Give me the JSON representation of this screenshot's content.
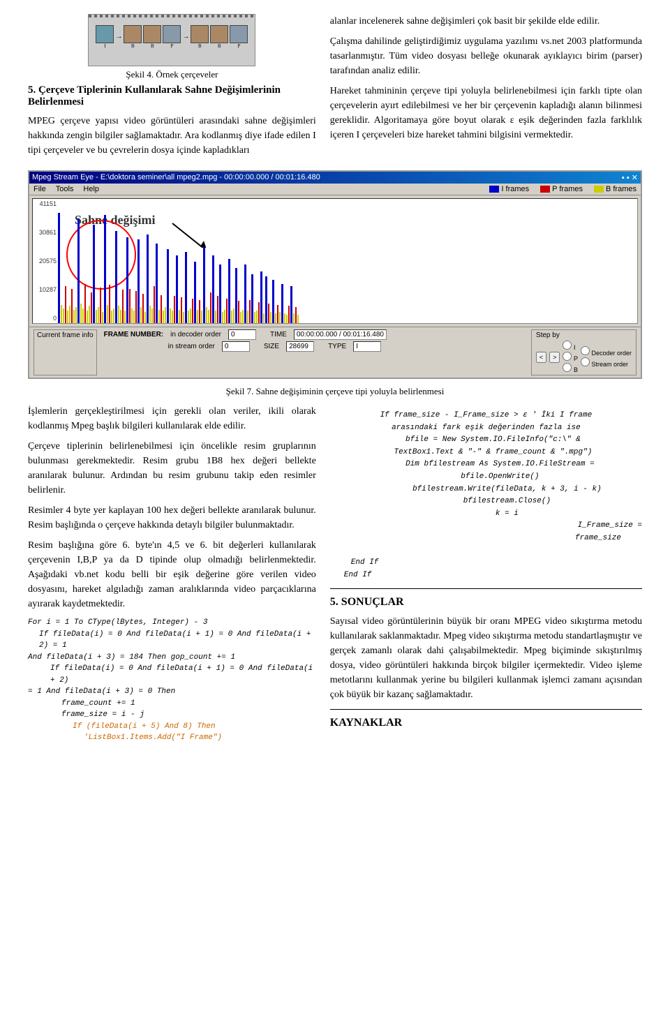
{
  "top": {
    "figure4_caption": "Şekil 4. Örnek çerçeveler",
    "right_para1": "alanlar incelenerek sahne değişimleri çok basit bir şekilde elde edilir.",
    "right_para2": "Çalışma dahilinde geliştirdiğimiz uygulama yazılımı vs.net 2003 platformunda tasarlanmıştır. Tüm video dosyası belleğe okunarak ayıklayıcı birim (parser) tarafından analiz edilir."
  },
  "section5": {
    "title": "5. Çerçeve Tiplerinin Kullanılarak Sahne Değişimlerinin Belirlenmesi",
    "para1": "MPEG çerçeve yapısı video görüntüleri arasındaki sahne değişimleri hakkında zengin bilgiler sağlamaktadır. Ara kodlanmış diye ifade edilen I tipi çerçeveler ve bu çevrelerin dosya içinde kapladıkları"
  },
  "right_middle": {
    "para1": "Hareket tahmininin çerçeve tipi yoluyla belirlenebilmesi için farklı tipte olan çerçevelerin ayırt edilebilmesi ve her bir çerçevenin kapladığı alanın bilinmesi gereklidir. Algoritamaya göre boyut olarak ε eşik değerinden fazla farklılık içeren I çerçeveleri bize hareket tahmini bilgisini vermektedir."
  },
  "mpeg_viewer": {
    "title": "Mpeg Stream Eye - E:\\doktora seminer\\all mpeg2.mpg - 00:00:00.000 / 00:01:16.480",
    "menu": [
      "File",
      "Tools",
      "Help"
    ],
    "legend": [
      {
        "label": "I frames",
        "color": "#0000cc"
      },
      {
        "label": "P frames",
        "color": "#cc0000"
      },
      {
        "label": "B frames",
        "color": "#cccc00"
      }
    ],
    "y_labels": [
      "41151",
      "30861",
      "20575",
      "10287",
      "0"
    ],
    "sahne_label": "Sahne değişimi",
    "frame_info": {
      "frame_number_label": "FRAME NUMBER:",
      "decoder_order_label": "in decoder order",
      "stream_order_label": "in stream order",
      "decoder_val": "0",
      "stream_val": "0",
      "time_label": "TIME",
      "time_val": "00:00:00.000 / 00:01:16.480",
      "size_label": "SIZE",
      "size_val": "28699",
      "type_label": "TYPE",
      "type_val": "I",
      "current_frame_label": "Current frame info",
      "step_by_label": "Step by"
    }
  },
  "fig7_caption": "Şekil 7. Sahne değişiminin çerçeve tipi yoluyla belirlenmesi",
  "left_lower": {
    "para1": "İşlemlerin gerçekleştirilmesi için gerekli olan veriler, ikili olarak kodlanmış Mpeg başlık bilgileri kullanılarak elde edilir.",
    "para2": "Çerçeve tiplerinin belirlenebilmesi için öncelikle resim gruplarının bulunması gerekmektedir. Resim grubu 1B8 hex değeri bellekte aranılarak bulunur. Ardından bu resim grubunu takip eden resimler belirlenir.",
    "para3": "Resimler 4 byte yer kaplayan 100 hex değeri bellekte aranılarak bulunur. Resim başlığında o çerçeve hakkında detaylı bilgiler bulunmaktadır.",
    "para4": "Resim başlığına göre 6. byte'ın 4,5 ve 6. bit değerleri kullanılarak çerçevenin I,B,P ya da D tipinde olup olmadığı belirlenmektedir. Aşağıdaki vb.net kodu belli bir eşik değerine göre verilen video dosyasını, hareket algıladığı zaman aralıklarında video parçacıklarına ayırarak kaydetmektedir."
  },
  "code_left": {
    "lines": [
      {
        "text": "For i = 1 To CType(lBytes, Integer) - 3",
        "style": "normal"
      },
      {
        "text": "  If fileData(i) = 0 And fileData(i + 1) = 0 And fileData(i + 2) = 1",
        "style": "normal"
      },
      {
        "text": "And fileData(i + 3) = 184 Then gop_count += 1",
        "style": "normal"
      },
      {
        "text": "    If fileData(i) = 0 And fileData(i + 1) = 0 And fileData(i + 2)",
        "style": "normal"
      },
      {
        "text": "= 1 And fileData(i + 3) = 0 Then",
        "style": "normal"
      },
      {
        "text": "      frame_count += 1",
        "style": "normal"
      },
      {
        "text": "      frame_size = i - j",
        "style": "normal"
      },
      {
        "text": "        If (fileData(i + 5) And 8) Then",
        "style": "orange"
      },
      {
        "text": "          'ListBox1.Items.Add(\"I Frame\")",
        "style": "orange"
      }
    ]
  },
  "code_right": {
    "lines": [
      {
        "text": "If frame_size - I_Frame_size > ε ' İki I frame",
        "style": "italic"
      },
      {
        "text": "arasındaki fark eşik değerinden fazla ise",
        "style": "italic"
      },
      {
        "text": "  bfile = New System.IO.FileInfo(\"c:\\\" &",
        "style": "indent"
      },
      {
        "text": "TextBox1.Text & \"-\" & frame_count & \".mpg\")",
        "style": "indent"
      },
      {
        "text": "    Dim bfilestream As System.IO.FileStream =",
        "style": "indent2"
      },
      {
        "text": "bfile.OpenWrite()",
        "style": "indent2"
      },
      {
        "text": "    bfilestream.Write(fileData, k + 3, i - k)",
        "style": "indent3"
      },
      {
        "text": "    bfilestream.Close()",
        "style": "indent3"
      },
      {
        "text": "    k = i",
        "style": "indent3"
      },
      {
        "text": "                    I_Frame_size =",
        "style": "right"
      },
      {
        "text": "frame_size",
        "style": "right"
      },
      {
        "text": "",
        "style": "normal"
      },
      {
        "text": "End If",
        "style": "indent-end"
      },
      {
        "text": "End If",
        "style": "indent-end"
      }
    ]
  },
  "section5_results": {
    "title": "5. SONUÇLAR",
    "para1": "Sayısal video görüntülerinin büyük bir oranı MPEG video sıkıştırma metodu kullanılarak saklanmaktadır. Mpeg video sıkıştırma metodu standartlaşmıştır ve gerçek zamanlı olarak dahi çalışabilmektedir. Mpeg biçiminde sıkıştırılmış dosya, video görüntüleri hakkında birçok bilgiler içermektedir. Video işleme metotlarını kullanmak yerine bu bilgileri kullanmak işlemci zamanı açısından çok büyük bir kazanç sağlamaktadır."
  },
  "section_kaynaklar": {
    "title": "KAYNAKLAR"
  }
}
